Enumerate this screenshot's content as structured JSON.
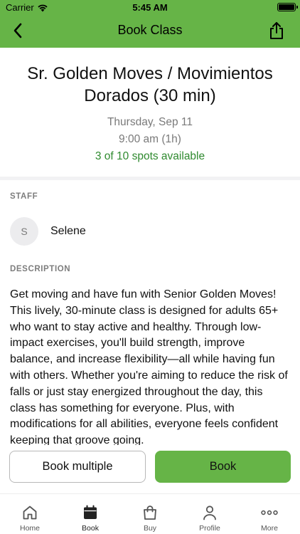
{
  "status_bar": {
    "carrier": "Carrier",
    "time": "5:45 AM"
  },
  "nav": {
    "title": "Book Class",
    "back_icon": "chevron-left-icon",
    "share_icon": "share-icon"
  },
  "class_info": {
    "title": "Sr. Golden Moves / Movimientos Dorados (30 min)",
    "date": "Thursday, Sep 11",
    "time": "9:00 am (1h)",
    "spots": "3 of 10 spots available"
  },
  "staff": {
    "label": "STAFF",
    "avatar_initial": "S",
    "name": "Selene"
  },
  "description": {
    "label": "DESCRIPTION",
    "text": "Get moving and have fun with Senior Golden Moves! This lively, 30-minute class is designed for adults 65+ who want to stay active and healthy. Through low-impact exercises, you'll build strength, improve balance, and increase flexibility—all while having fun with others. Whether you're aiming to reduce the risk of falls or just stay energized throughout the day, this class has something for everyone. Plus, with modifications for all abilities, everyone feels confident keeping that groove going."
  },
  "actions": {
    "book_multiple": "Book multiple",
    "book": "Book"
  },
  "tabs": [
    {
      "label": "Home",
      "icon": "home-icon"
    },
    {
      "label": "Book",
      "icon": "calendar-icon",
      "active": true
    },
    {
      "label": "Buy",
      "icon": "shopping-bag-icon"
    },
    {
      "label": "Profile",
      "icon": "person-icon"
    },
    {
      "label": "More",
      "icon": "more-dots-icon"
    }
  ],
  "colors": {
    "brand_green": "#66b447",
    "spots_green": "#2f8a2f",
    "muted_text": "#7a7a7a"
  }
}
